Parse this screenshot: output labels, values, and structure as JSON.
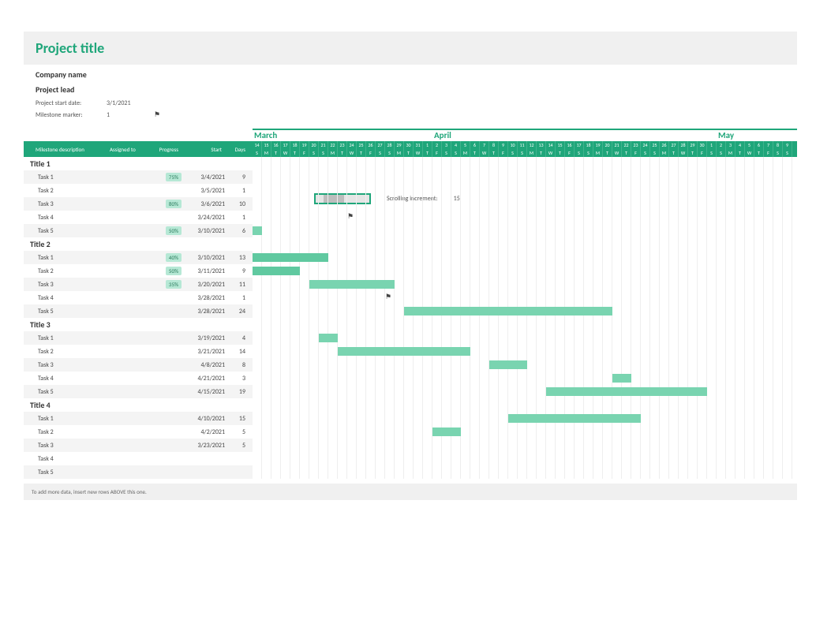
{
  "header": {
    "project_title": "Project title",
    "company_name": "Company name",
    "project_lead": "Project lead",
    "start_date_label": "Project start date:",
    "start_date_value": "3/1/2021",
    "milestone_label": "Milestone marker:",
    "milestone_value": "1",
    "scrolling_label": "Scrolling increment:",
    "scrolling_value": "15"
  },
  "columns": {
    "desc": "Milestone description",
    "assigned": "Assigned to",
    "progress": "Progress",
    "start": "Start",
    "days": "Days"
  },
  "months": {
    "m1": "March",
    "m2": "April",
    "m3": "May"
  },
  "timeline_start_day": 14,
  "sections": [
    {
      "title": "Title 1",
      "tasks": [
        {
          "name": "Task 1",
          "progress": "75%",
          "start": "3/4/2021",
          "days": "9",
          "bar": null
        },
        {
          "name": "Task 2",
          "progress": "",
          "start": "3/5/2021",
          "days": "1",
          "bar": null
        },
        {
          "name": "Task 3",
          "progress": "80%",
          "start": "3/6/2021",
          "days": "10",
          "bar": null
        },
        {
          "name": "Task 4",
          "progress": "",
          "start": "3/24/2021",
          "days": "1",
          "bar": null,
          "flag_col": 10
        },
        {
          "name": "Task 5",
          "progress": "50%",
          "start": "3/10/2021",
          "days": "6",
          "bar": {
            "col": 0,
            "span": 1
          }
        }
      ]
    },
    {
      "title": "Title 2",
      "tasks": [
        {
          "name": "Task 1",
          "progress": "40%",
          "start": "3/10/2021",
          "days": "13",
          "bar": {
            "col": 0,
            "span": 8,
            "solid": true
          }
        },
        {
          "name": "Task 2",
          "progress": "50%",
          "start": "3/11/2021",
          "days": "9",
          "bar": {
            "col": 0,
            "span": 5,
            "solid": true
          }
        },
        {
          "name": "Task 3",
          "progress": "35%",
          "start": "3/20/2021",
          "days": "11",
          "bar": {
            "col": 6,
            "span": 9
          }
        },
        {
          "name": "Task 4",
          "progress": "",
          "start": "3/28/2021",
          "days": "1",
          "bar": null,
          "flag_col": 14
        },
        {
          "name": "Task 5",
          "progress": "",
          "start": "3/28/2021",
          "days": "24",
          "bar": {
            "col": 16,
            "span": 22
          }
        }
      ]
    },
    {
      "title": "Title 3",
      "tasks": [
        {
          "name": "Task 1",
          "progress": "",
          "start": "3/19/2021",
          "days": "4",
          "bar": {
            "col": 7,
            "span": 2
          }
        },
        {
          "name": "Task 2",
          "progress": "",
          "start": "3/21/2021",
          "days": "14",
          "bar": {
            "col": 9,
            "span": 14
          }
        },
        {
          "name": "Task 3",
          "progress": "",
          "start": "4/8/2021",
          "days": "8",
          "bar": {
            "col": 25,
            "span": 4
          }
        },
        {
          "name": "Task 4",
          "progress": "",
          "start": "4/21/2021",
          "days": "3",
          "bar": {
            "col": 38,
            "span": 2
          }
        },
        {
          "name": "Task 5",
          "progress": "",
          "start": "4/15/2021",
          "days": "19",
          "bar": {
            "col": 31,
            "span": 17
          }
        }
      ]
    },
    {
      "title": "Title 4",
      "tasks": [
        {
          "name": "Task 1",
          "progress": "",
          "start": "4/10/2021",
          "days": "15",
          "bar": {
            "col": 27,
            "span": 14
          }
        },
        {
          "name": "Task 2",
          "progress": "",
          "start": "4/2/2021",
          "days": "5",
          "bar": {
            "col": 19,
            "span": 3
          }
        },
        {
          "name": "Task 3",
          "progress": "",
          "start": "3/23/2021",
          "days": "5",
          "bar": null
        },
        {
          "name": "Task 4",
          "progress": "",
          "start": "",
          "days": "",
          "bar": null
        },
        {
          "name": "Task 5",
          "progress": "",
          "start": "",
          "days": "",
          "bar": null
        }
      ]
    }
  ],
  "footer": "To add more data, insert new rows ABOVE this one.",
  "chart_data": {
    "type": "gantt",
    "timeline": {
      "start": "2021-03-14",
      "months": [
        "March",
        "April",
        "May"
      ]
    },
    "groups": [
      {
        "title": "Title 1",
        "tasks": [
          {
            "name": "Task 1",
            "start": "2021-03-04",
            "days": 9,
            "progress": 0.75
          },
          {
            "name": "Task 2",
            "start": "2021-03-05",
            "days": 1
          },
          {
            "name": "Task 3",
            "start": "2021-03-06",
            "days": 10,
            "progress": 0.8
          },
          {
            "name": "Task 4",
            "start": "2021-03-24",
            "days": 1,
            "milestone": true
          },
          {
            "name": "Task 5",
            "start": "2021-03-10",
            "days": 6,
            "progress": 0.5
          }
        ]
      },
      {
        "title": "Title 2",
        "tasks": [
          {
            "name": "Task 1",
            "start": "2021-03-10",
            "days": 13,
            "progress": 0.4
          },
          {
            "name": "Task 2",
            "start": "2021-03-11",
            "days": 9,
            "progress": 0.5
          },
          {
            "name": "Task 3",
            "start": "2021-03-20",
            "days": 11,
            "progress": 0.35
          },
          {
            "name": "Task 4",
            "start": "2021-03-28",
            "days": 1,
            "milestone": true
          },
          {
            "name": "Task 5",
            "start": "2021-03-28",
            "days": 24
          }
        ]
      },
      {
        "title": "Title 3",
        "tasks": [
          {
            "name": "Task 1",
            "start": "2021-03-19",
            "days": 4
          },
          {
            "name": "Task 2",
            "start": "2021-03-21",
            "days": 14
          },
          {
            "name": "Task 3",
            "start": "2021-04-08",
            "days": 8
          },
          {
            "name": "Task 4",
            "start": "2021-04-21",
            "days": 3
          },
          {
            "name": "Task 5",
            "start": "2021-04-15",
            "days": 19
          }
        ]
      },
      {
        "title": "Title 4",
        "tasks": [
          {
            "name": "Task 1",
            "start": "2021-04-10",
            "days": 15
          },
          {
            "name": "Task 2",
            "start": "2021-04-02",
            "days": 5
          },
          {
            "name": "Task 3",
            "start": "2021-03-23",
            "days": 5
          },
          {
            "name": "Task 4"
          },
          {
            "name": "Task 5"
          }
        ]
      }
    ]
  }
}
